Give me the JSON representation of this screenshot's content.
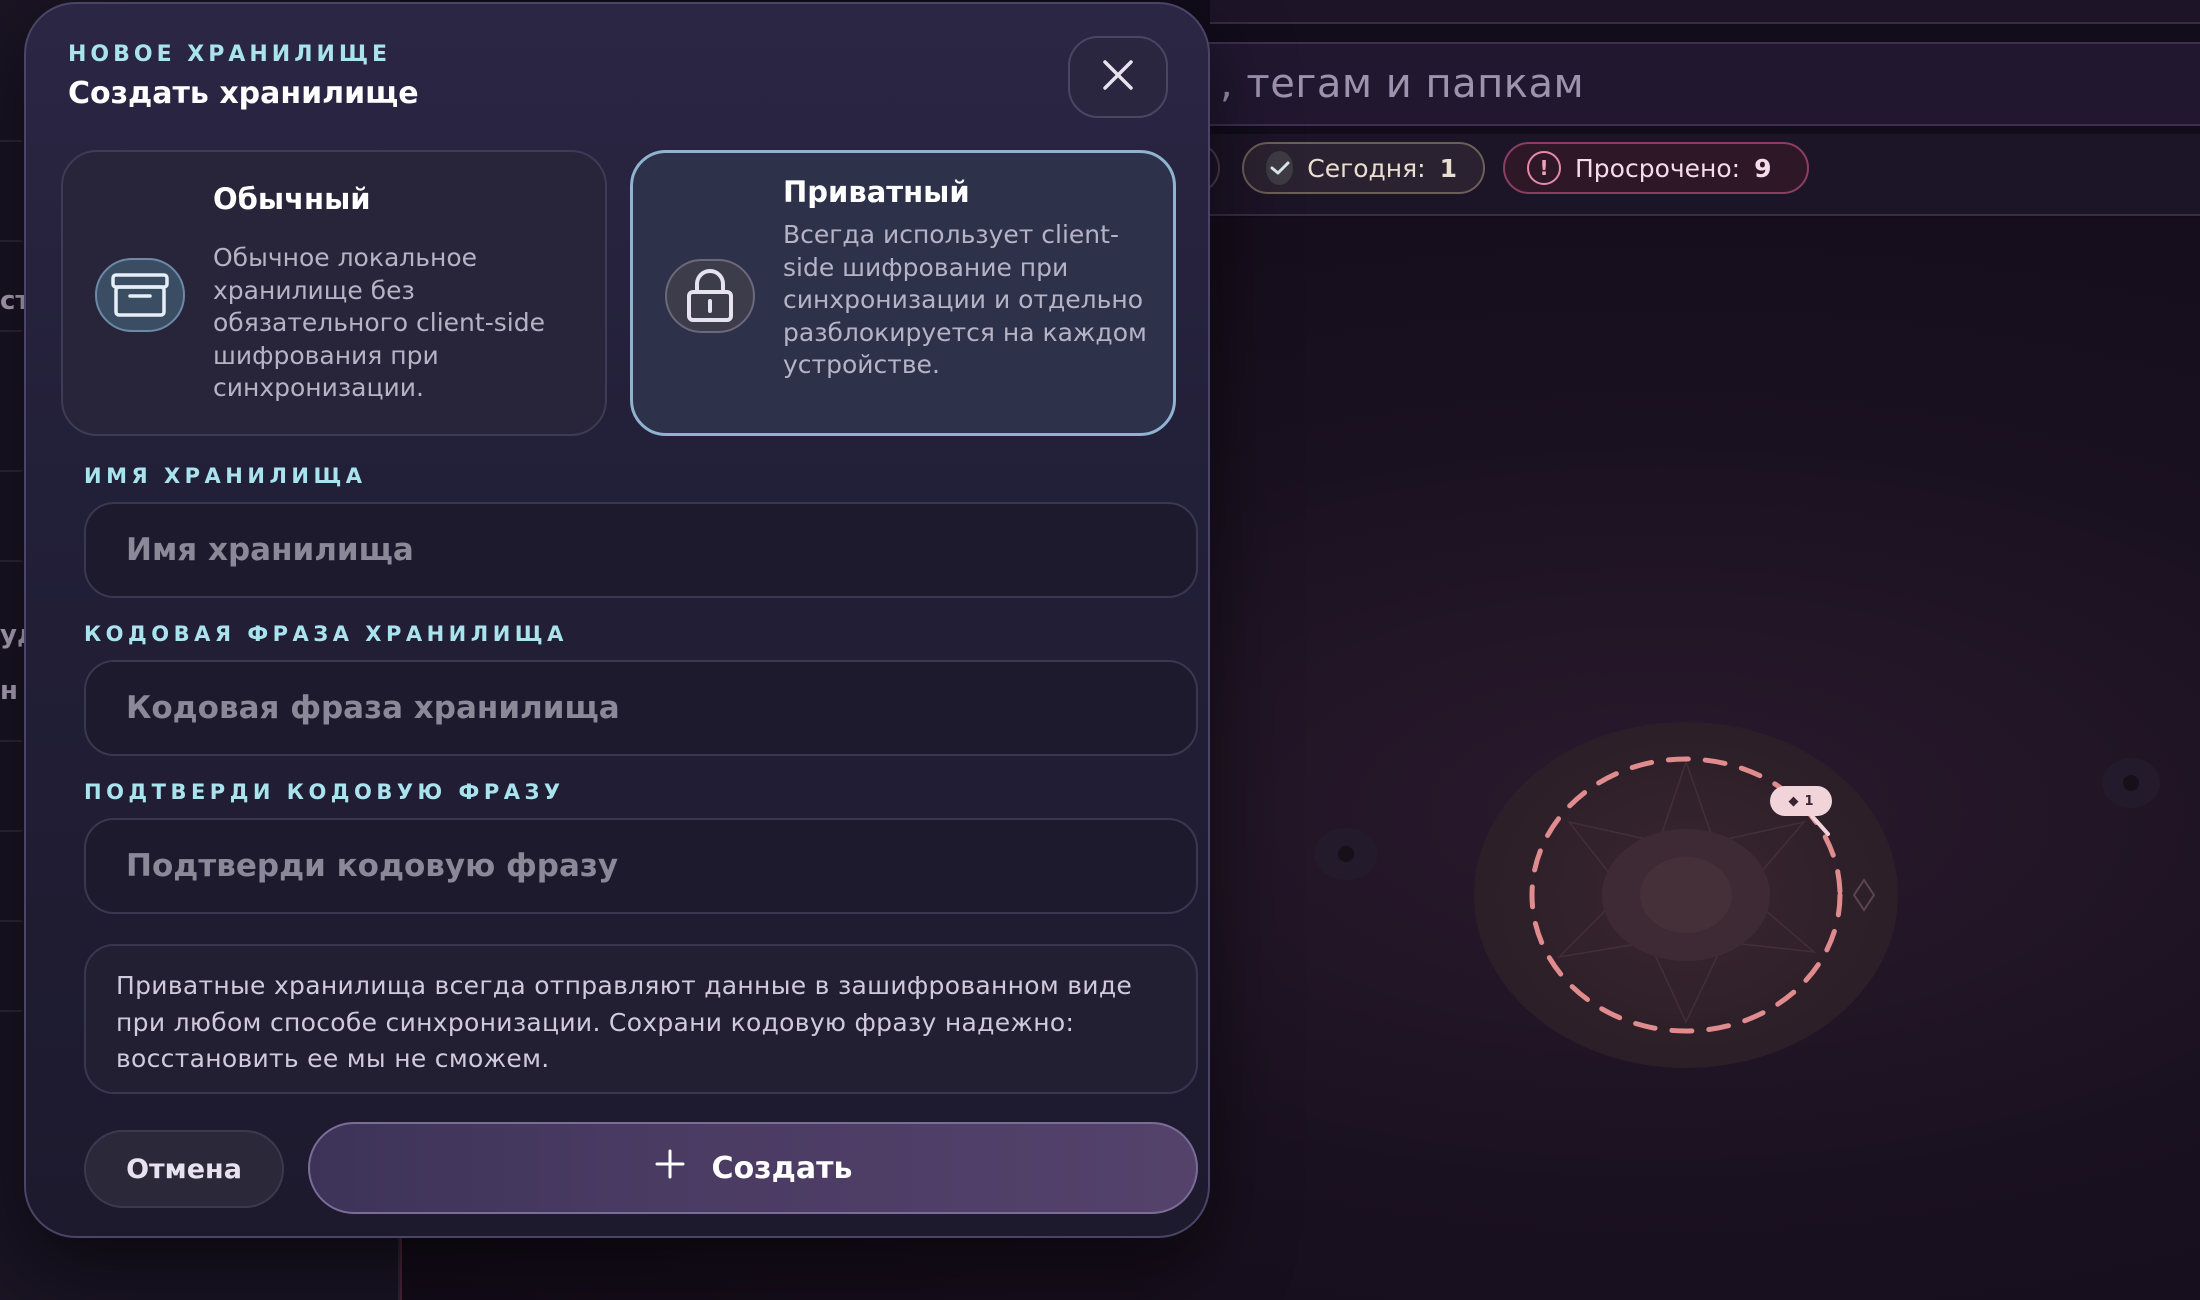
{
  "background": {
    "search_placeholder": ", тегам и папкам",
    "left_fragments": [
      "ст",
      "уд",
      "н"
    ],
    "chips": {
      "today_label": "Сегодня:",
      "today_value": "1",
      "overdue_label": "Просрочено:",
      "overdue_value": "9"
    },
    "orb_badge": "1"
  },
  "modal": {
    "eyebrow": "НОВОЕ ХРАНИЛИЩЕ",
    "title": "Создать хранилище",
    "close_icon": "close-icon",
    "types": [
      {
        "title": "Обычный",
        "description": "Обычное локальное хранилище без обязательного client-side шифрования при синхронизации.",
        "icon": "archive-box-icon",
        "selected": false
      },
      {
        "title": "Приватный",
        "description": "Всегда использует client-side шифрование при синхронизации и отдельно разблокируется на каждом устройстве.",
        "icon": "lock-icon",
        "selected": true
      }
    ],
    "fields": {
      "name": {
        "label": "ИМЯ ХРАНИЛИЩА",
        "placeholder": "Имя хранилища",
        "value": ""
      },
      "passphrase": {
        "label": "КОДОВАЯ ФРАЗА ХРАНИЛИЩА",
        "placeholder": "Кодовая фраза хранилища",
        "value": ""
      },
      "confirm": {
        "label": "ПОДТВЕРДИ КОДОВУЮ ФРАЗУ",
        "placeholder": "Подтверди кодовую фразу",
        "value": ""
      }
    },
    "info": "Приватные хранилища всегда отправляют данные в зашифрованном виде при любом способе синхронизации. Сохрани кодовую фразу надежно: восстановить ее мы не сможем.",
    "cancel_label": "Отмена",
    "create_label": "Создать",
    "create_icon": "plus-icon"
  },
  "colors": {
    "accent_label": "#a9e3ee",
    "selected_border": "#8fb3d1",
    "overdue": "#8c3d62"
  }
}
